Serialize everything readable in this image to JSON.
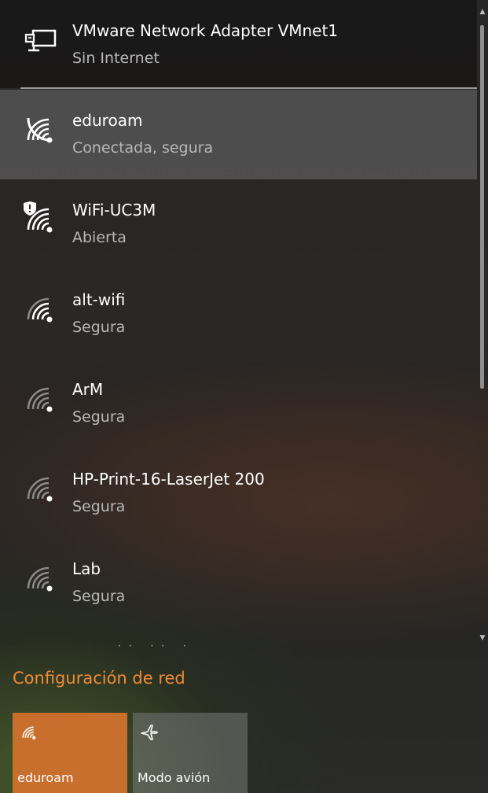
{
  "networks": [
    {
      "name": "VMware Network Adapter VMnet1",
      "status": "Sin Internet",
      "icon": "ethernet-icon"
    },
    {
      "name": "eduroam",
      "status": "Conectada, segura",
      "icon": "wifi-icon"
    },
    {
      "name": "WiFi-UC3M",
      "status": "Abierta",
      "icon": "wifi-open-shield-icon"
    },
    {
      "name": "alt-wifi",
      "status": "Segura",
      "icon": "wifi-icon"
    },
    {
      "name": "ArM",
      "status": "Segura",
      "icon": "wifi-weak-icon"
    },
    {
      "name": "HP-Print-16-LaserJet 200",
      "status": "Segura",
      "icon": "wifi-weak-icon"
    },
    {
      "name": "Lab",
      "status": "Segura",
      "icon": "wifi-weak-icon"
    }
  ],
  "settings_link": "Configuración de red",
  "quick_actions": [
    {
      "label": "eduroam",
      "icon": "wifi-icon",
      "active": true
    },
    {
      "label": "Modo avión",
      "icon": "airplane-icon",
      "active": false
    }
  ],
  "colors": {
    "accent": "#c86f2e",
    "link": "#f08a36",
    "status_text": "#b8b8b8"
  }
}
